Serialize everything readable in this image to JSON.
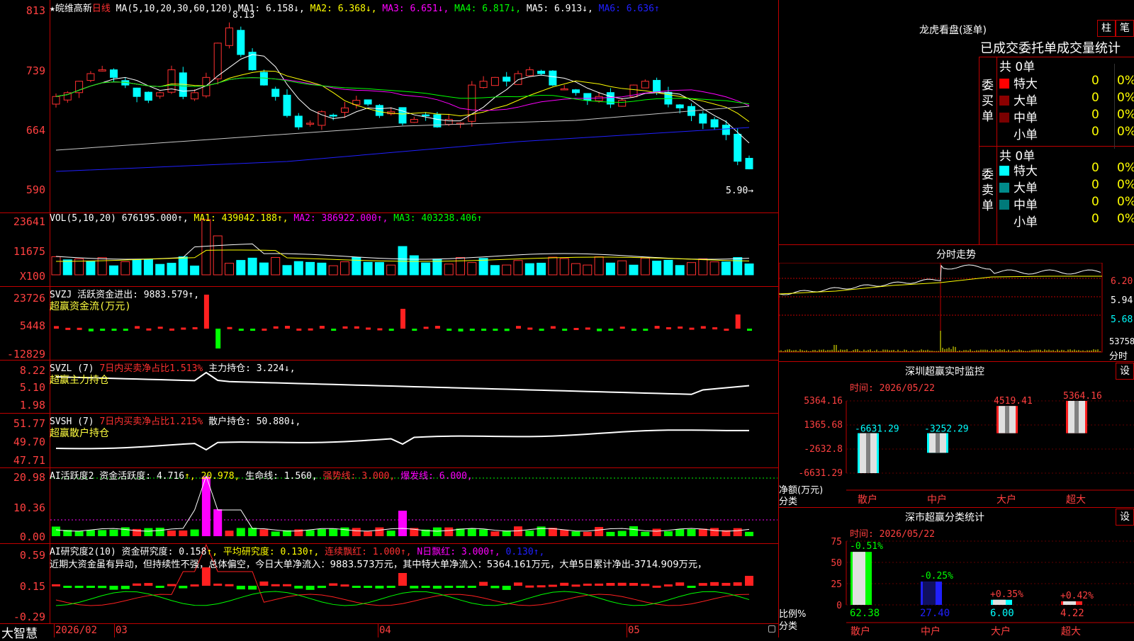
{
  "kline": {
    "name": "★皖维高新",
    "period": "日线",
    "ma_def": "MA(5,10,20,30,60,120)",
    "ma1": "MA1: 6.158↓,",
    "ma2": "MA2: 6.368↓,",
    "ma3": "MA3: 6.651↓,",
    "ma4": "MA4: 6.817↓,",
    "ma5": "MA5: 6.913↓,",
    "ma6": "MA6: 6.636↑",
    "yticks": [
      "813",
      "739",
      "664",
      "590"
    ],
    "high_label": "8.13",
    "low_label": "5.90→"
  },
  "vol": {
    "title": "VOL(5,10,20)",
    "value": "676195.000↑,",
    "ma1": "MA1: 439042.188↑,",
    "ma2": "MA2: 386922.000↑,",
    "ma3": "MA3: 403238.406↑",
    "yticks": [
      "23641",
      "11675",
      "X100"
    ]
  },
  "svzj": {
    "title": "SVZJ  活跃资金进出: 9883.579↑,",
    "subtitle": "超赢资金流(万元)",
    "yticks": [
      "23726",
      "5448",
      "-12829"
    ]
  },
  "svzl": {
    "title_a": "SVZL (7) ",
    "title_b": "7日内买卖净占比1.513%",
    "title_c": " 主力持仓: 3.224↓,",
    "subtitle": "超赢主力持仓",
    "yticks": [
      "8.22",
      "5.10",
      "1.98"
    ]
  },
  "svsh": {
    "title_a": "SVSH (7) ",
    "title_b": "7日内买卖净占比1.215%",
    "title_c": " 散户持仓: 50.880↓,",
    "subtitle": "超赢散户持仓",
    "yticks": [
      "51.77",
      "49.70",
      "47.71"
    ]
  },
  "ai2": {
    "title_a": "AI活跃度2 资金活跃度: 4.716",
    "title_b": "↑, 20.978,",
    "title_c": " 生命线: 1.560,",
    "title_d": " 强势线: 3.000,",
    "title_e": " 爆发线: 6.000,",
    "yticks": [
      "20.98",
      "10.36",
      "0.00"
    ]
  },
  "research": {
    "title_a": "AI研究度2(10) 资金研究度: 0.158",
    "title_b": "↑, 平均研究度: 0.130↑,",
    "title_c": " 连续飘红: 1.000↑,",
    "title_d": " N日飘红: 3.000↑,",
    "title_e": " 0.130↑,",
    "comment": "近期大资金虽有异动，但持续性不强，总体偏空，今日大单净流入：9883.573万元，其中特大单净流入：5364.161万元，大单5日累计净出-3714.909万元，",
    "yticks": [
      "0.59",
      "0.15",
      "-0.29"
    ]
  },
  "xaxis": {
    "brand": "大智慧",
    "labels": [
      "2026/02",
      "03",
      "04",
      "05"
    ]
  },
  "longhu": {
    "title": "龙虎看盘(逐单)",
    "btn1": "柱",
    "btn2": "笔",
    "tabs": "已成交委托单成交量统计",
    "buy_label": "委买单",
    "sell_label": "委卖单",
    "buy_total": "共 0单",
    "sell_total": "共 0单",
    "buy_rows": [
      {
        "name": "特大",
        "n": "0",
        "p": "0%",
        "color": "#ff0000"
      },
      {
        "name": "大单",
        "n": "0",
        "p": "0%",
        "color": "#8b0000"
      },
      {
        "name": "中单",
        "n": "0",
        "p": "0%",
        "color": "#7a0000"
      },
      {
        "name": "小单",
        "n": "0",
        "p": "0%",
        "color": ""
      }
    ],
    "sell_rows": [
      {
        "name": "特大",
        "n": "0",
        "p": "0%",
        "color": "#00ffff"
      },
      {
        "name": "大单",
        "n": "0",
        "p": "0%",
        "color": "#008b8b"
      },
      {
        "name": "中单",
        "n": "0",
        "p": "0%",
        "color": "#007a7a"
      },
      {
        "name": "小单",
        "n": "0",
        "p": "0%",
        "color": ""
      }
    ]
  },
  "fenshi": {
    "title": "分时走势",
    "yticks": [
      "6.20",
      "5.94",
      "5.68",
      "53758"
    ],
    "label": "分时"
  },
  "sz_monitor": {
    "title": "深圳超赢实时监控",
    "btn": "设",
    "time": "时间: 2026/05/22",
    "yticks": [
      "5364.16",
      "1365.68",
      "-2632.8",
      "-6631.29"
    ],
    "ylabel": "净额(万元)",
    "xlabel": "分类",
    "bars": [
      {
        "cat": "散户",
        "value": -6631.29,
        "label": "-6631.29"
      },
      {
        "cat": "中户",
        "value": -3252.29,
        "label": "-3252.29"
      },
      {
        "cat": "大户",
        "value": 4519.41,
        "label": "4519.41"
      },
      {
        "cat": "超大",
        "value": 5364.16,
        "label": "5364.16"
      }
    ]
  },
  "sz_class": {
    "title": "深市超赢分类统计",
    "btn": "设",
    "time": "时间: 2026/05/22",
    "yticks": [
      "75",
      "50",
      "25",
      "0"
    ],
    "ylabel": "比例%",
    "xlabel": "分类",
    "bars": [
      {
        "cat": "散户",
        "value": 62.38,
        "label": "62.38",
        "delta": "-0.51%"
      },
      {
        "cat": "中户",
        "value": 27.4,
        "label": "27.40",
        "delta": "-0.25%"
      },
      {
        "cat": "大户",
        "value": 6.0,
        "label": "6.00",
        "delta": "+0.35%"
      },
      {
        "cat": "超大",
        "value": 4.22,
        "label": "4.22",
        "delta": "+0.42%"
      }
    ]
  },
  "chart_data": [
    {
      "type": "bar",
      "title": "深圳超赢实时监控",
      "categories": [
        "散户",
        "中户",
        "大户",
        "超大"
      ],
      "values": [
        -6631.29,
        -3252.29,
        4519.41,
        5364.16
      ],
      "ylabel": "净额(万元)",
      "xlabel": "分类",
      "ylim": [
        -6631.29,
        5364.16
      ]
    },
    {
      "type": "bar",
      "title": "深市超赢分类统计",
      "categories": [
        "散户",
        "中户",
        "大户",
        "超大"
      ],
      "values": [
        62.38,
        27.4,
        6.0,
        4.22
      ],
      "ylabel": "比例%",
      "xlabel": "分类",
      "ylim": [
        0,
        75
      ]
    }
  ]
}
